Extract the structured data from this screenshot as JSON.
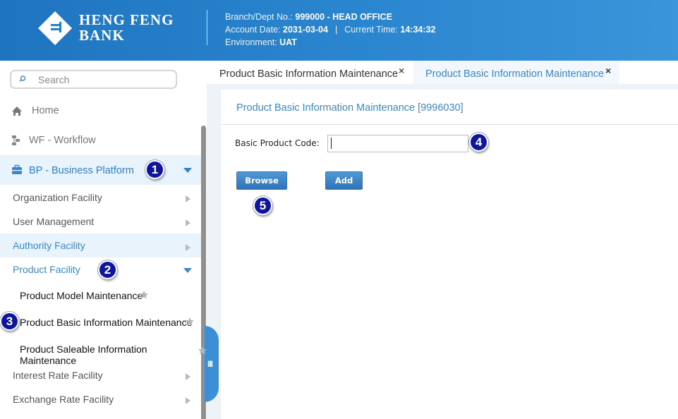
{
  "header": {
    "logo_line1": "HENG FENG",
    "logo_line2": "BANK",
    "branch_label": "Branch/Dept No.:",
    "branch_value": "999000 - HEAD OFFICE",
    "account_date_label": "Account Date:",
    "account_date_value": "2031-03-04",
    "separator": "|",
    "current_time_label": "Current Time:",
    "current_time_value": "14:34:32",
    "environment_label": "Environment:",
    "environment_value": "UAT",
    "colors": {
      "primary": "#1f74bf",
      "accent": "#3b87c8"
    }
  },
  "sidebar": {
    "search": {
      "placeholder": "Search",
      "icon": "search-icon"
    },
    "top_items": [
      {
        "label": "Home",
        "icon": "home-icon"
      },
      {
        "label": "WF - Workflow",
        "icon": "workflow-icon"
      },
      {
        "label": "BP - Business Platform",
        "icon": "briefcase-icon",
        "expanded": true
      }
    ],
    "sub_items": [
      {
        "label": "Organization Facility"
      },
      {
        "label": "User Management"
      },
      {
        "label": "Authority Facility",
        "state": "hover"
      },
      {
        "label": "Product Facility",
        "expanded": true
      }
    ],
    "leaf_items": [
      {
        "label": "Product Model Maintenance"
      },
      {
        "label": "Product Basic Information Maintenance"
      },
      {
        "label": "Product Saleable Information Maintenance"
      }
    ],
    "more_items": [
      {
        "label": "Interest Rate Facility"
      },
      {
        "label": "Exchange Rate Facility"
      }
    ],
    "collapse_handle_glyph": "III"
  },
  "tabs": [
    {
      "label": "Product Basic Information Maintenance",
      "close": "×",
      "active": false
    },
    {
      "label": "Product Basic Information Maintenance",
      "close": "×",
      "active": true
    }
  ],
  "panel": {
    "title": "Product Basic Information Maintenance [9996030]",
    "field_label": "Basic Product Code:",
    "field_value": "",
    "browse_label": "Browse",
    "add_label": "Add"
  },
  "callouts": [
    "1",
    "2",
    "3",
    "4",
    "5"
  ]
}
